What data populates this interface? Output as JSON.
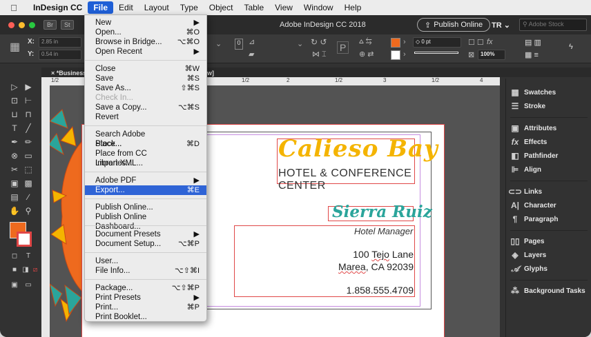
{
  "menubar": {
    "app_name": "InDesign CC",
    "items": [
      "File",
      "Edit",
      "Layout",
      "Type",
      "Object",
      "Table",
      "View",
      "Window",
      "Help"
    ],
    "active": "File"
  },
  "window": {
    "title": "Adobe InDesign CC 2018",
    "badges": [
      "Br",
      "St"
    ],
    "publish_label": "Publish Online",
    "workspace": "TR",
    "search_placeholder": "Adobe Stock"
  },
  "controlbar": {
    "x_label": "X:",
    "x_value": "2.85 in",
    "y_label": "Y:",
    "y_value": "0.54 in",
    "stroke_weight": "0 pt",
    "scale": "100%",
    "fill_color": "#ee6a1e"
  },
  "document": {
    "tab_name": "*Business",
    "tab_suffix": "w]",
    "ruler_labels": [
      "1/2",
      "1/2",
      "2",
      "1/2",
      "3",
      "1/2",
      "4"
    ],
    "card": {
      "title": "Calieso Bay",
      "subtitle": "HOTEL & CONFERENCE CENTER",
      "name": "Sierra Ruiz",
      "role": "Hotel Manager",
      "address1_pre": "100 ",
      "address1_word": "Tejo",
      "address1_post": " Lane",
      "address2_word": "Marea",
      "address2_post": ", CA 92039",
      "phone": "1.858.555.4709"
    },
    "colors": {
      "title": "#f4b400",
      "name": "#2aa59b",
      "frame": "#e04646",
      "margin": "#c58be0"
    }
  },
  "file_menu": {
    "items": [
      {
        "label": "New",
        "shortcut": "▶",
        "disabled": false,
        "selected": false
      },
      {
        "label": "Open...",
        "shortcut": "⌘O",
        "disabled": false,
        "selected": false
      },
      {
        "label": "Browse in Bridge...",
        "shortcut": "⌥⌘O",
        "disabled": false,
        "selected": false
      },
      {
        "label": "Open Recent",
        "shortcut": "▶",
        "disabled": false,
        "selected": false
      },
      {
        "label": "Close",
        "shortcut": "⌘W",
        "disabled": false,
        "selected": false
      },
      {
        "label": "Save",
        "shortcut": "⌘S",
        "disabled": false,
        "selected": false
      },
      {
        "label": "Save As...",
        "shortcut": "⇧⌘S",
        "disabled": false,
        "selected": false
      },
      {
        "label": "Check In...",
        "shortcut": "",
        "disabled": true,
        "selected": false
      },
      {
        "label": "Save a Copy...",
        "shortcut": "⌥⌘S",
        "disabled": false,
        "selected": false
      },
      {
        "label": "Revert",
        "shortcut": "",
        "disabled": false,
        "selected": false
      },
      {
        "label": "Search Adobe Stock...",
        "shortcut": "",
        "disabled": false,
        "selected": false
      },
      {
        "label": "Place...",
        "shortcut": "⌘D",
        "disabled": false,
        "selected": false
      },
      {
        "label": "Place from CC Libraries...",
        "shortcut": "",
        "disabled": false,
        "selected": false
      },
      {
        "label": "Import XML...",
        "shortcut": "",
        "disabled": false,
        "selected": false
      },
      {
        "label": "Adobe PDF Presets",
        "shortcut": "▶",
        "disabled": false,
        "selected": false
      },
      {
        "label": "Export...",
        "shortcut": "⌘E",
        "disabled": false,
        "selected": true
      },
      {
        "label": "Publish Online...",
        "shortcut": "",
        "disabled": false,
        "selected": false
      },
      {
        "label": "Publish Online Dashboard...",
        "shortcut": "",
        "disabled": false,
        "selected": false
      },
      {
        "label": "Document Presets",
        "shortcut": "▶",
        "disabled": false,
        "selected": false
      },
      {
        "label": "Document Setup...",
        "shortcut": "⌥⌘P",
        "disabled": false,
        "selected": false
      },
      {
        "label": "User...",
        "shortcut": "",
        "disabled": false,
        "selected": false
      },
      {
        "label": "File Info...",
        "shortcut": "⌥⇧⌘I",
        "disabled": false,
        "selected": false
      },
      {
        "label": "Package...",
        "shortcut": "⌥⇧⌘P",
        "disabled": false,
        "selected": false
      },
      {
        "label": "Print Presets",
        "shortcut": "▶",
        "disabled": false,
        "selected": false
      },
      {
        "label": "Print...",
        "shortcut": "⌘P",
        "disabled": false,
        "selected": false
      },
      {
        "label": "Print Booklet...",
        "shortcut": "",
        "disabled": false,
        "selected": false
      }
    ]
  },
  "right_panel": {
    "items": [
      {
        "label": "Swatches",
        "icon": "swatches-icon"
      },
      {
        "label": "Stroke",
        "icon": "stroke-icon"
      },
      {
        "label": "Attributes",
        "icon": "attributes-icon"
      },
      {
        "label": "Effects",
        "icon": "fx-icon"
      },
      {
        "label": "Pathfinder",
        "icon": "pathfinder-icon"
      },
      {
        "label": "Align",
        "icon": "align-icon"
      },
      {
        "label": "Links",
        "icon": "links-icon"
      },
      {
        "label": "Character",
        "icon": "character-icon"
      },
      {
        "label": "Paragraph",
        "icon": "paragraph-icon"
      },
      {
        "label": "Pages",
        "icon": "pages-icon"
      },
      {
        "label": "Layers",
        "icon": "layers-icon"
      },
      {
        "label": "Glyphs",
        "icon": "glyphs-icon"
      },
      {
        "label": "Background Tasks",
        "icon": "background-tasks-icon"
      }
    ]
  }
}
